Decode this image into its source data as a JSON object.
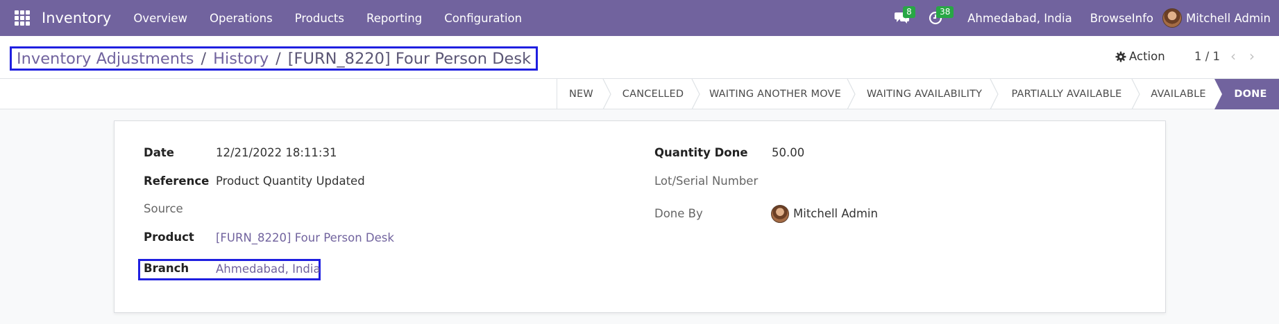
{
  "navbar": {
    "app_name": "Inventory",
    "menu": [
      "Overview",
      "Operations",
      "Products",
      "Reporting",
      "Configuration"
    ],
    "messages_count": "8",
    "activities_count": "38",
    "company": "Ahmedabad, India",
    "org": "BrowseInfo",
    "user": "Mitchell Admin"
  },
  "breadcrumb": {
    "items": [
      "Inventory Adjustments",
      "History",
      "[FURN_8220] Four Person Desk"
    ]
  },
  "control": {
    "action_label": "Action",
    "pager": "1 / 1"
  },
  "status": {
    "stages": [
      "NEW",
      "CANCELLED",
      "WAITING ANOTHER MOVE",
      "WAITING AVAILABILITY",
      "PARTIALLY AVAILABLE",
      "AVAILABLE",
      "DONE"
    ],
    "current": "DONE"
  },
  "form": {
    "date_label": "Date",
    "date": "12/21/2022 18:11:31",
    "reference_label": "Reference",
    "reference": "Product Quantity Updated",
    "source_label": "Source",
    "source": "",
    "product_label": "Product",
    "product": "[FURN_8220] Four Person Desk",
    "branch_label": "Branch",
    "branch": "Ahmedabad, India",
    "qty_done_label": "Quantity Done",
    "qty_done": "50.00",
    "lot_label": "Lot/Serial Number",
    "lot": "",
    "done_by_label": "Done By",
    "done_by": "Mitchell Admin"
  },
  "colors": {
    "brand": "#71639e",
    "badge": "#28a745",
    "highlight_box": "#1f1fe0"
  }
}
